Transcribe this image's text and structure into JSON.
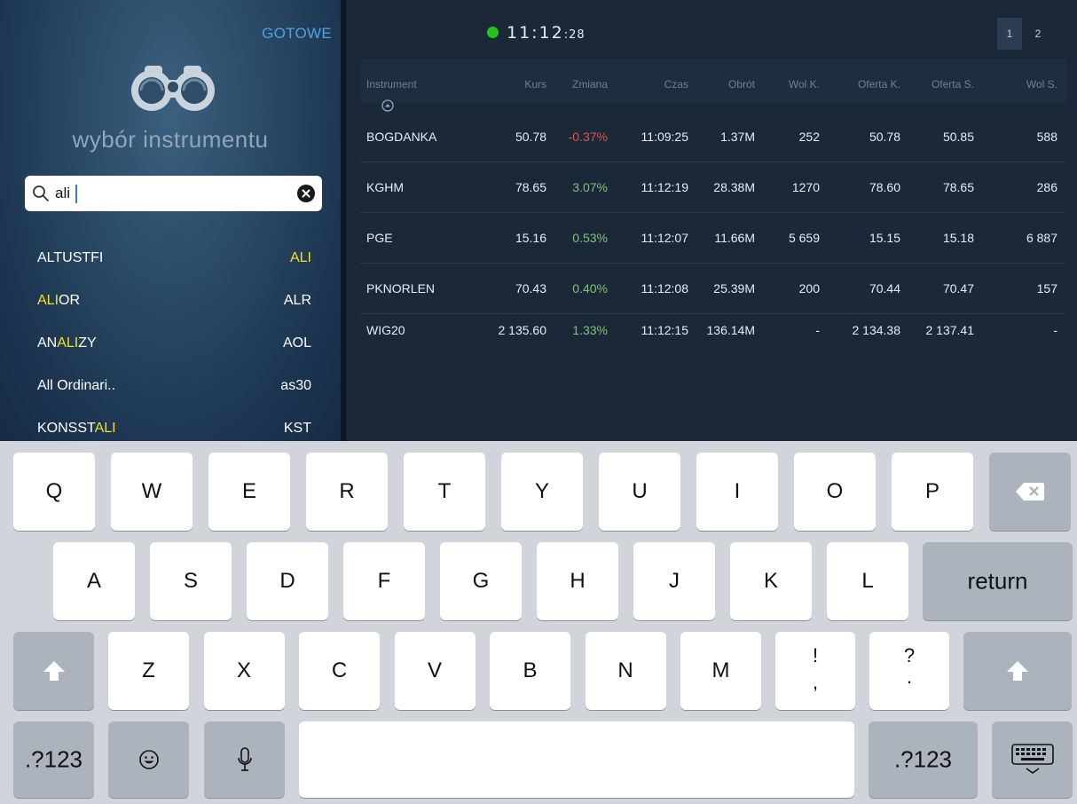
{
  "left_panel": {
    "done_label": "GOTOWE",
    "title": "wybór instrumentu",
    "search": {
      "value": "ali",
      "placeholder": ""
    },
    "results": [
      {
        "name_parts": [
          "ALTUSTFI"
        ],
        "name_highlight": [
          false
        ],
        "symbol_parts": [
          "ALI"
        ],
        "symbol_highlight": [
          true
        ]
      },
      {
        "name_parts": [
          "ALI",
          "OR"
        ],
        "name_highlight": [
          true,
          false
        ],
        "symbol_parts": [
          "ALR"
        ],
        "symbol_highlight": [
          false
        ]
      },
      {
        "name_parts": [
          "AN",
          "ALI",
          "ZY"
        ],
        "name_highlight": [
          false,
          true,
          false
        ],
        "symbol_parts": [
          "AOL"
        ],
        "symbol_highlight": [
          false
        ]
      },
      {
        "name_parts": [
          "All Ordinari.."
        ],
        "name_highlight": [
          false
        ],
        "symbol_parts": [
          "as30"
        ],
        "symbol_highlight": [
          false
        ]
      },
      {
        "name_parts": [
          "KONSST",
          "ALI"
        ],
        "name_highlight": [
          false,
          true
        ],
        "symbol_parts": [
          "KST"
        ],
        "symbol_highlight": [
          false
        ]
      }
    ]
  },
  "quotes": {
    "clock_main": "11:12",
    "clock_seconds": ":28",
    "pages": [
      "1",
      "2"
    ],
    "columns": [
      "Instrument",
      "Kurs",
      "Zmiana",
      "Czas",
      "Obrót",
      "Wol K.",
      "Oferta K.",
      "Oferta S.",
      "Wol S."
    ],
    "rows": [
      {
        "instrument": "BOGDANKA",
        "kurs": "50.78",
        "zmiana": "-0.37%",
        "czas": "11:09:25",
        "obrot": "1.37M",
        "wol_k": "252",
        "oferta_k": "50.78",
        "oferta_s": "50.85",
        "wol_s": "588",
        "direction": "down"
      },
      {
        "instrument": "KGHM",
        "kurs": "78.65",
        "zmiana": "3.07%",
        "czas": "11:12:19",
        "obrot": "28.38M",
        "wol_k": "1270",
        "oferta_k": "78.60",
        "oferta_s": "78.65",
        "wol_s": "286",
        "direction": "up"
      },
      {
        "instrument": "PGE",
        "kurs": "15.16",
        "zmiana": "0.53%",
        "czas": "11:12:07",
        "obrot": "11.66M",
        "wol_k": "5 659",
        "oferta_k": "15.15",
        "oferta_s": "15.18",
        "wol_s": "6 887",
        "direction": "up"
      },
      {
        "instrument": "PKNORLEN",
        "kurs": "70.43",
        "zmiana": "0.40%",
        "czas": "11:12:08",
        "obrot": "25.39M",
        "wol_k": "200",
        "oferta_k": "70.44",
        "oferta_s": "70.47",
        "wol_s": "157",
        "direction": "up"
      },
      {
        "instrument": "WIG20",
        "kurs": "2 135.60",
        "zmiana": "1.33%",
        "czas": "11:12:15",
        "obrot": "136.14M",
        "wol_k": "-",
        "oferta_k": "2 134.38",
        "oferta_s": "2 137.41",
        "wol_s": "-",
        "direction": "up"
      }
    ]
  },
  "keyboard": {
    "row1": [
      "Q",
      "W",
      "E",
      "R",
      "T",
      "Y",
      "U",
      "I",
      "O",
      "P"
    ],
    "row2": [
      "A",
      "S",
      "D",
      "F",
      "G",
      "H",
      "J",
      "K",
      "L"
    ],
    "row3": [
      "Z",
      "X",
      "C",
      "V",
      "B",
      "N",
      "M"
    ],
    "punct1": [
      "!",
      ","
    ],
    "punct2": [
      "?",
      "."
    ],
    "return_label": "return",
    "numbers_label": ".?123"
  },
  "colors": {
    "accent": "#4da3e6",
    "highlight": "#f3e21a",
    "negative": "#e0554a",
    "positive": "#7cc47a",
    "status_online": "#22c41c"
  },
  "icons": [
    "binoculars-icon",
    "search-icon",
    "clear-icon",
    "sort-ascending-icon",
    "backspace-icon",
    "shift-icon",
    "emoji-icon",
    "microphone-icon",
    "hide-keyboard-icon"
  ]
}
